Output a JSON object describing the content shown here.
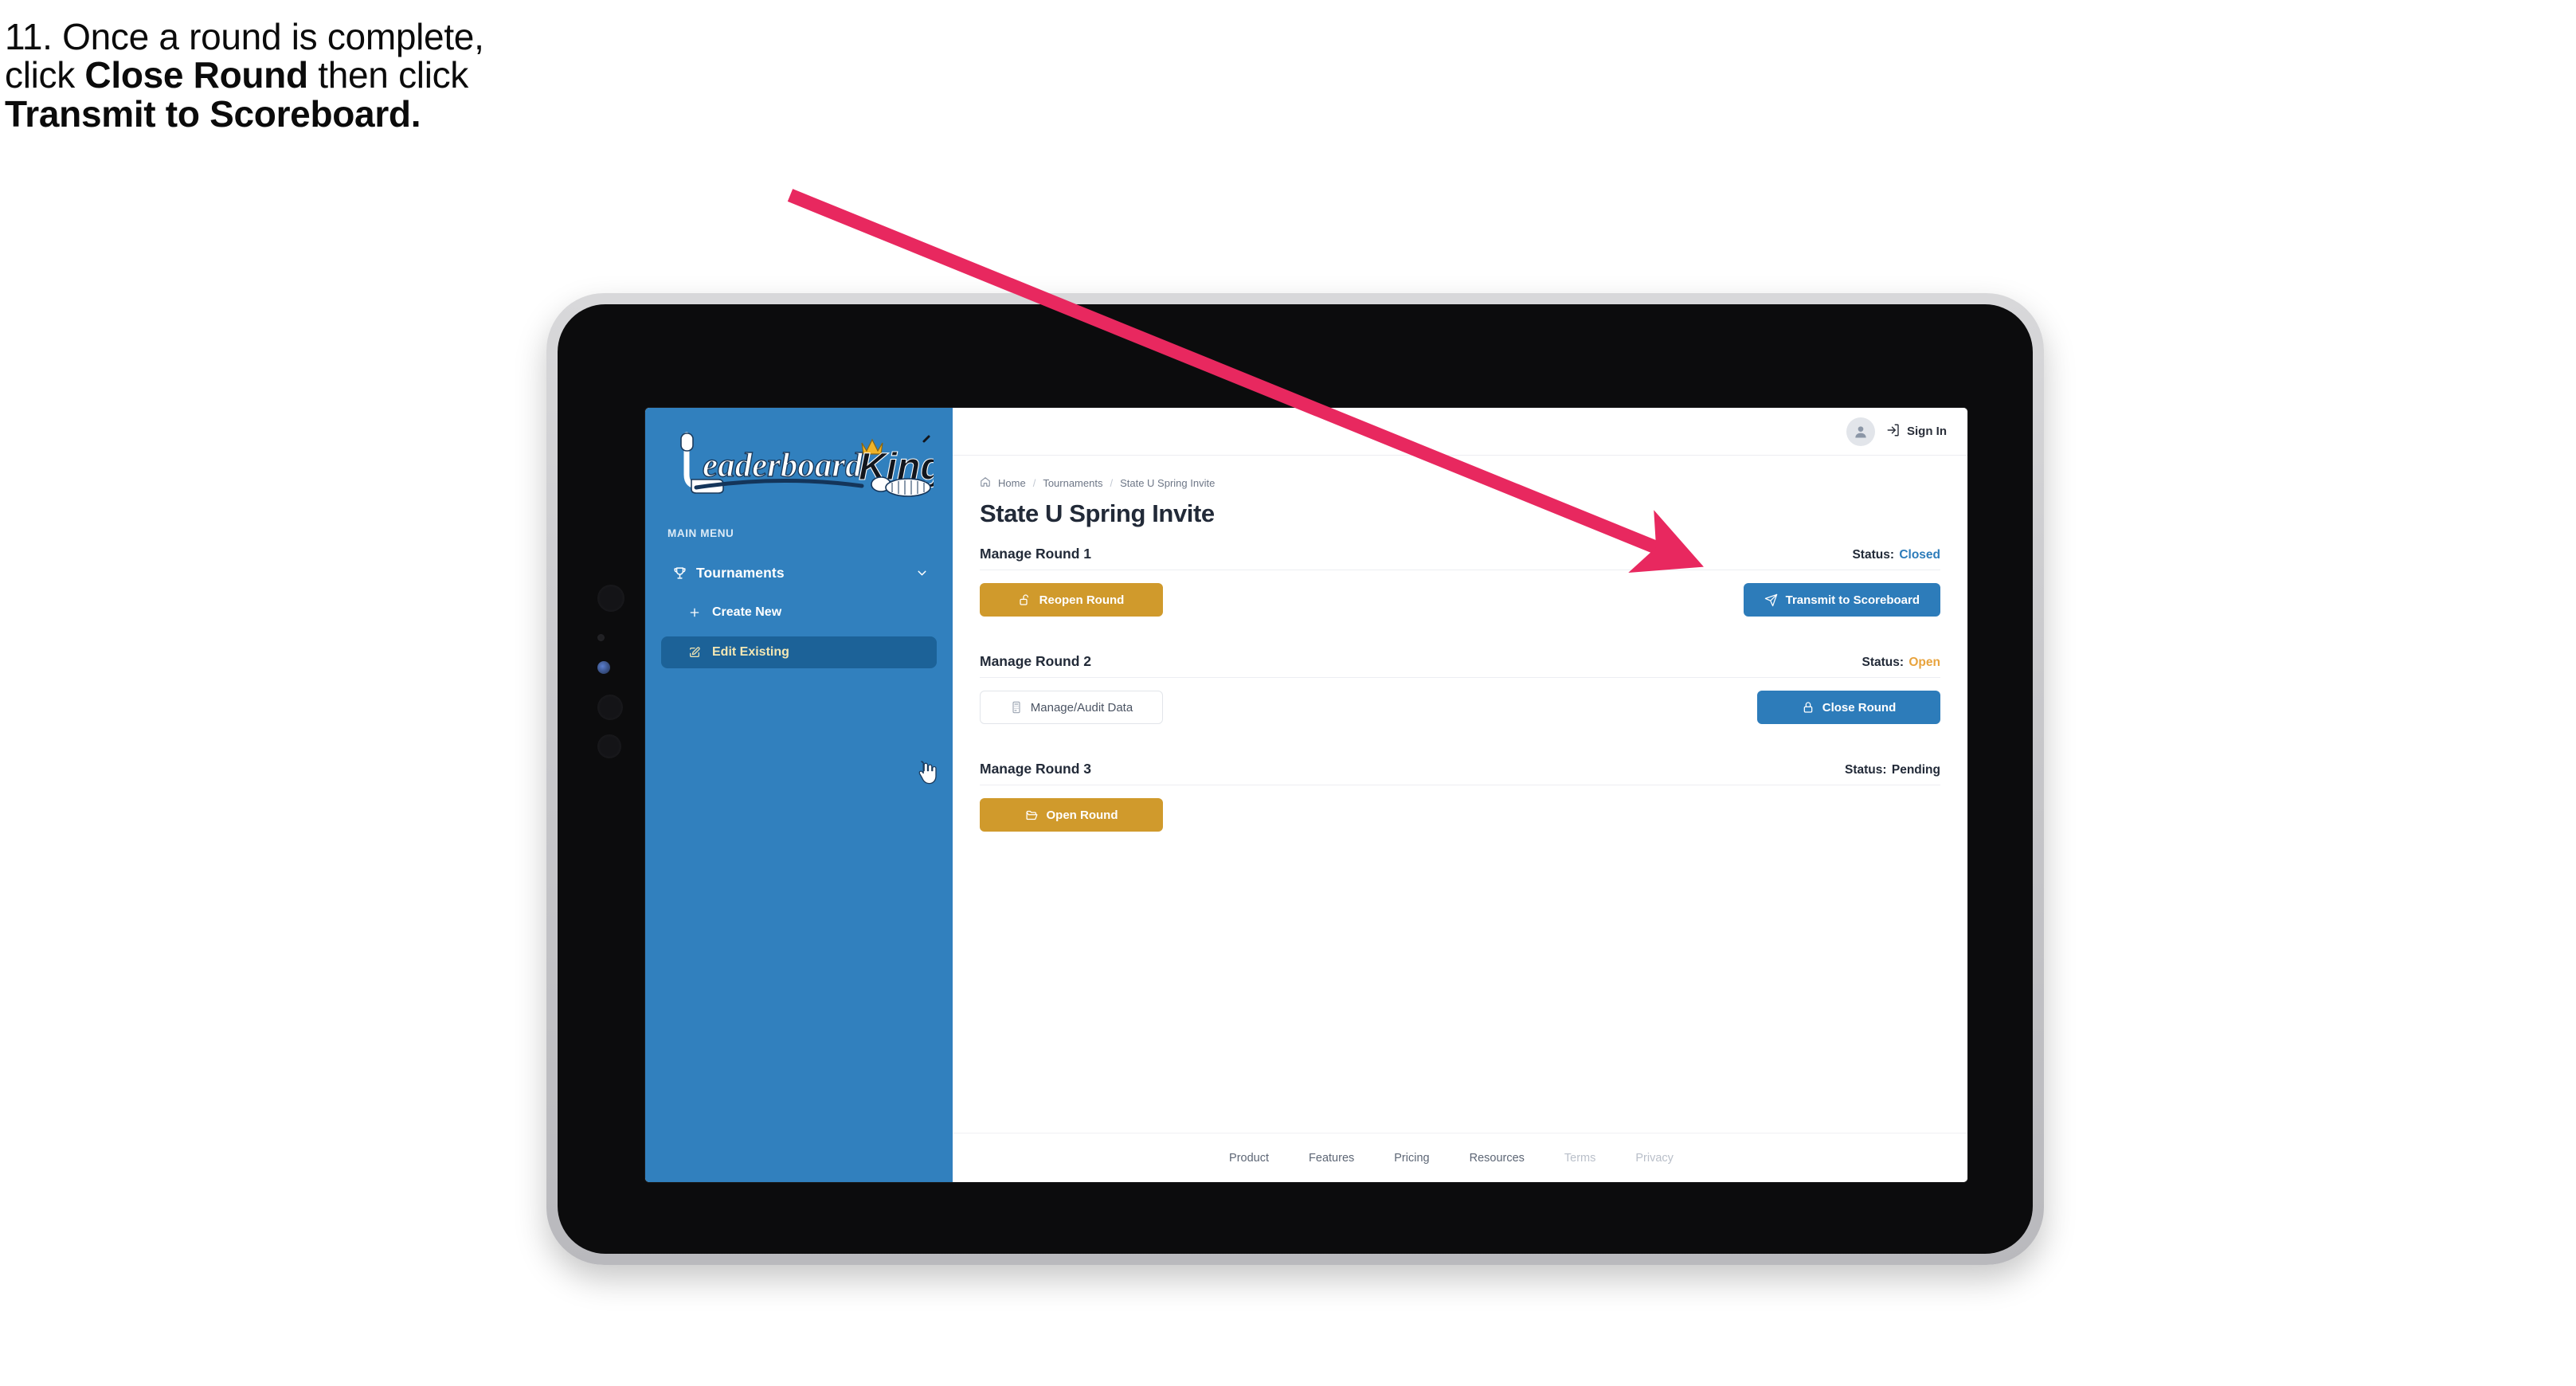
{
  "instruction": {
    "line1": "11. Once a round is complete,",
    "line2_pre": "click ",
    "line2_bold": "Close Round",
    "line2_post": " then click",
    "line3_bold": "Transmit to Scoreboard."
  },
  "app": {
    "logo": {
      "word_script": "Leaderboard",
      "word_bold": "King"
    },
    "sidebar": {
      "section_label": "MAIN MENU",
      "nav": {
        "label": "Tournaments",
        "icon": "trophy-icon",
        "chevron": "chevron-down-icon"
      },
      "items": [
        {
          "label": "Create New",
          "icon": "plus-icon",
          "active": false
        },
        {
          "label": "Edit Existing",
          "icon": "edit-square-icon",
          "active": true
        }
      ]
    },
    "topbar": {
      "avatar_icon": "user-avatar-icon",
      "signin_icon": "login-arrow-icon",
      "signin_label": "Sign In"
    },
    "breadcrumb": {
      "home_icon": "home-icon",
      "items": [
        "Home",
        "Tournaments",
        "State U Spring Invite"
      ],
      "separator": "/"
    },
    "page_title": "State U Spring Invite",
    "status_label": "Status:",
    "rounds": [
      {
        "title": "Manage Round 1",
        "status_value": "Closed",
        "status_color": "#2d7cba",
        "left_button": {
          "label": "Reopen Round",
          "icon": "unlock-icon",
          "style": "gold"
        },
        "right_button": {
          "label": "Transmit to Scoreboard",
          "icon": "paper-plane-icon",
          "style": "blue"
        }
      },
      {
        "title": "Manage Round 2",
        "status_value": "Open",
        "status_color": "#e8a33d",
        "left_button": {
          "label": "Manage/Audit Data",
          "icon": "calculator-icon",
          "style": "ghost"
        },
        "right_button": {
          "label": "Close Round",
          "icon": "lock-icon",
          "style": "blue"
        }
      },
      {
        "title": "Manage Round 3",
        "status_value": "Pending",
        "status_color": "#222a38",
        "left_button": {
          "label": "Open Round",
          "icon": "folder-open-icon",
          "style": "gold"
        },
        "right_button": null
      }
    ],
    "footer": {
      "links": [
        {
          "label": "Product",
          "muted": false
        },
        {
          "label": "Features",
          "muted": false
        },
        {
          "label": "Pricing",
          "muted": false
        },
        {
          "label": "Resources",
          "muted": false
        },
        {
          "label": "Terms",
          "muted": true
        },
        {
          "label": "Privacy",
          "muted": true
        }
      ]
    }
  },
  "annotation": {
    "arrow_color": "#e8285f",
    "points_to": "Transmit to Scoreboard"
  }
}
